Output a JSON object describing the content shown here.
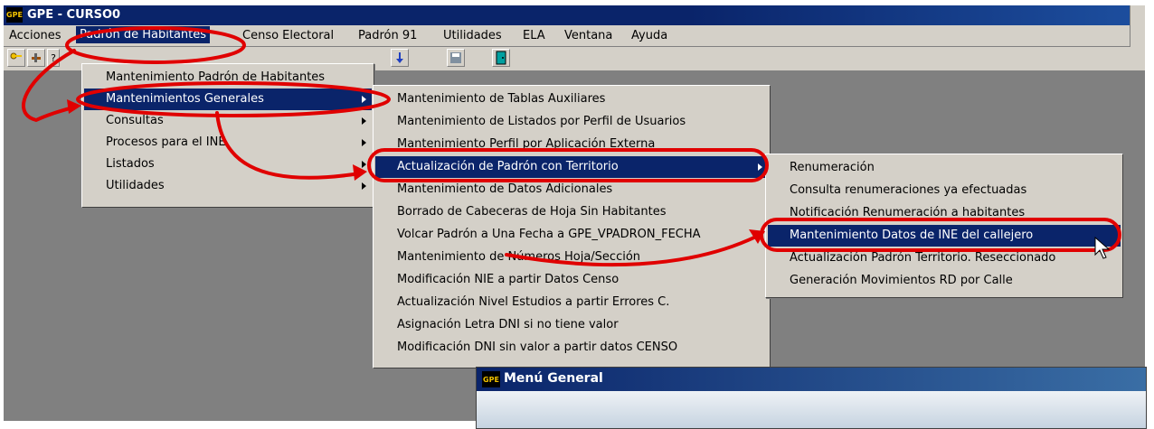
{
  "window": {
    "logo_text": "GPE",
    "title": "GPE - CURSO0"
  },
  "menubar": {
    "items": [
      {
        "label": "Acciones"
      },
      {
        "label": "Padrón de Habitantes"
      },
      {
        "label": "Censo Electoral"
      },
      {
        "label": "Padrón 91"
      },
      {
        "label": "Utilidades"
      },
      {
        "label": "ELA"
      },
      {
        "label": "Ventana"
      },
      {
        "label": "Ayuda"
      }
    ]
  },
  "toolbar": {
    "icons": [
      "key-icon",
      "tools-icon",
      "help-icon",
      "download-icon",
      "save-icon",
      "exit-door-icon"
    ]
  },
  "menu1": {
    "items": [
      {
        "label": "Mantenimiento Padrón de Habitantes"
      },
      {
        "label": "Mantenimientos Generales"
      },
      {
        "label": "Consultas"
      },
      {
        "label": "Procesos para el INE"
      },
      {
        "label": "Listados"
      },
      {
        "label": "Utilidades"
      }
    ]
  },
  "menu2": {
    "items": [
      {
        "label": "Mantenimiento de Tablas Auxiliares"
      },
      {
        "label": "Mantenimiento de Listados por Perfil de Usuarios"
      },
      {
        "label": "Mantenimiento Perfil por Aplicación Externa"
      },
      {
        "label": "Actualización de Padrón con Territorio"
      },
      {
        "label": "Mantenimiento de Datos Adicionales"
      },
      {
        "label": "Borrado de Cabeceras de Hoja Sin Habitantes"
      },
      {
        "label": "Volcar Padrón a Una Fecha a GPE_VPADRON_FECHA"
      },
      {
        "label": "Mantenimiento de Números Hoja/Sección"
      },
      {
        "label": "Modificación NIE a partir Datos Censo"
      },
      {
        "label": "Actualización Nivel Estudios a partir Errores C."
      },
      {
        "label": "Asignación Letra DNI si no tiene valor"
      },
      {
        "label": "Modificación DNI sin valor a partir datos  CENSO"
      }
    ]
  },
  "menu3": {
    "items": [
      {
        "label": "Renumeración"
      },
      {
        "label": "Consulta renumeraciones ya efectuadas"
      },
      {
        "label": "Notificación Renumeración a habitantes"
      },
      {
        "label": "Mantenimiento Datos de INE del callejero"
      },
      {
        "label": "Actualización Padrón Territorio. Reseccionado"
      },
      {
        "label": "Generación Movimientos RD por Calle"
      }
    ]
  },
  "child_window": {
    "logo_text": "GPE",
    "title": "Menú General"
  },
  "colors": {
    "title_bar": "#0a246a",
    "menu_bg": "#d4d0c8",
    "highlight": "#0a246a",
    "annotation": "#e00000",
    "workspace": "#808080"
  }
}
